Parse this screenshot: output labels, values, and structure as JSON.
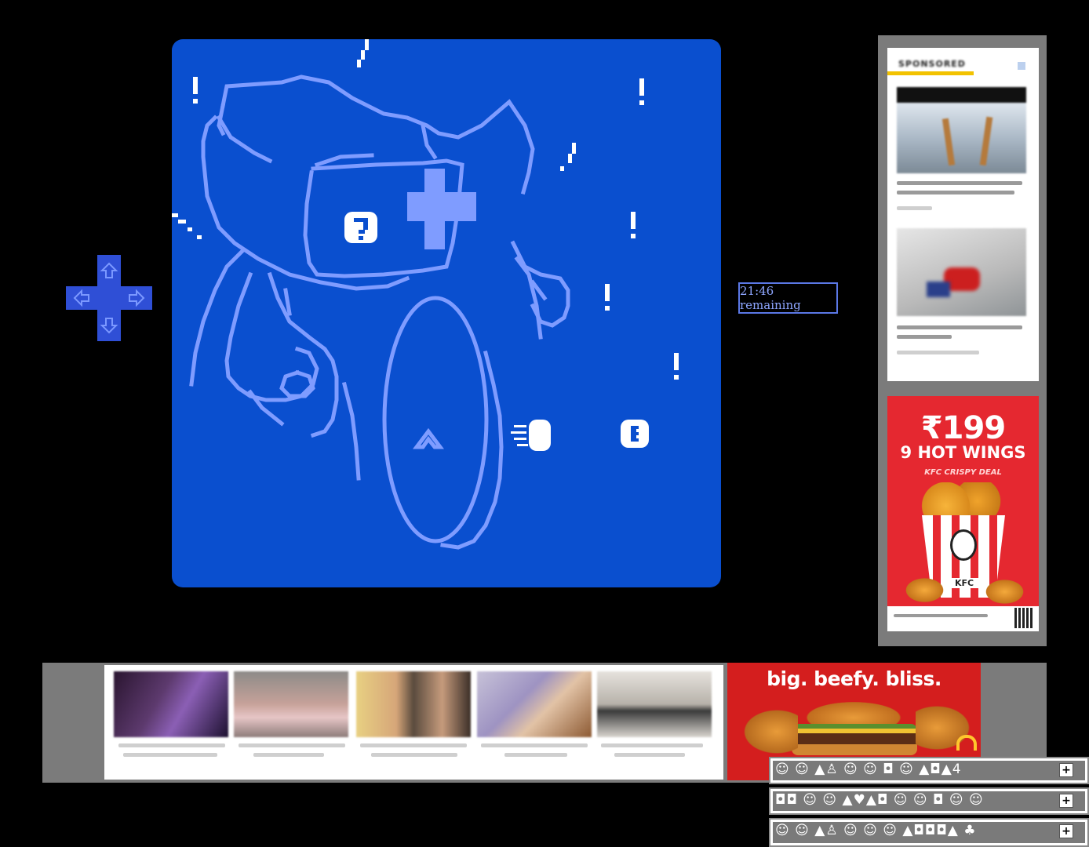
{
  "game": {
    "timer_text": "21:46 remaining",
    "screen_color": "#0a4fcf",
    "line_color": "#7f9cff",
    "icon_color": "#ffffff"
  },
  "ads": {
    "sponsored_header": "SPONSORED",
    "kfc": {
      "price": "₹199",
      "headline": "9 HOT WINGS",
      "sub": "KFC CRISPY DEAL",
      "bucket_label": "KFC"
    },
    "mcd": {
      "tagline": "big. beefy. bliss."
    }
  },
  "toolbar": {
    "rows": [
      {
        "glyphs": "☺ ☺ ▲♙ ☺ ☺ ◘ ☺ ▲◘▲4",
        "plus": "+"
      },
      {
        "glyphs": "◘◘ ☺ ☺ ▲♥▲◘ ☺ ☺ ◘ ☺ ☺",
        "plus": "+"
      },
      {
        "glyphs": "☺ ☺ ▲♙ ☺ ☺ ☺ ▲◘◘◘▲ ♣",
        "plus": "+"
      }
    ]
  }
}
